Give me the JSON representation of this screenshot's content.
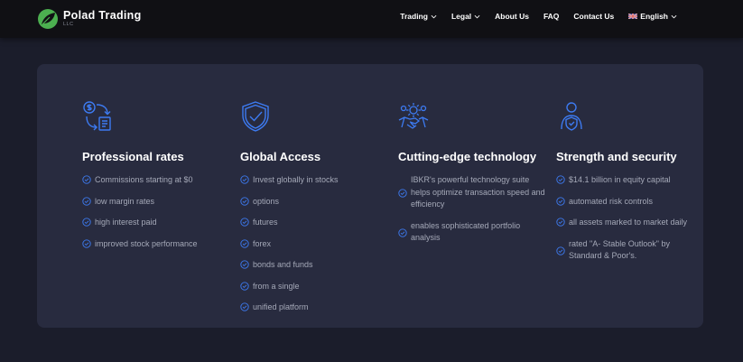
{
  "brand": {
    "name": "Polad Trading",
    "suffix": "LLC"
  },
  "nav": {
    "items": [
      {
        "label": "Trading",
        "dropdown": true
      },
      {
        "label": "Legal",
        "dropdown": true
      },
      {
        "label": "About Us",
        "dropdown": false
      },
      {
        "label": "FAQ",
        "dropdown": false
      },
      {
        "label": "Contact Us",
        "dropdown": false
      }
    ],
    "language": {
      "label": "English",
      "flag": "uk-flag-icon"
    }
  },
  "colors": {
    "page_bg": "#1b1d2b",
    "navbar_bg": "#101014",
    "card_bg": "#282b3f",
    "accent_blue": "#3d7bf2",
    "logo_green": "#4caf50",
    "text_muted": "#a5a9b8"
  },
  "features": [
    {
      "icon": "money-exchange-icon",
      "title": "Professional rates",
      "items": [
        "Commissions starting at $0",
        "low margin rates",
        "high interest paid",
        "improved stock performance"
      ]
    },
    {
      "icon": "shield-check-icon",
      "title": "Global Access",
      "items": [
        "Invest globally in stocks",
        "options",
        "futures",
        "forex",
        "bonds and funds",
        "from a single",
        "unified platform"
      ]
    },
    {
      "icon": "gear-handshake-icon",
      "title": "Cutting-edge technology",
      "items": [
        "IBKR's powerful technology suite helps optimize transaction speed and efficiency",
        "enables sophisticated portfolio analysis"
      ]
    },
    {
      "icon": "person-shield-icon",
      "title": "Strength and security",
      "items": [
        "$14.1 billion in equity capital",
        "automated risk controls",
        "all assets marked to market daily",
        "rated \"A- Stable Outlook\" by Standard & Poor's."
      ]
    }
  ]
}
